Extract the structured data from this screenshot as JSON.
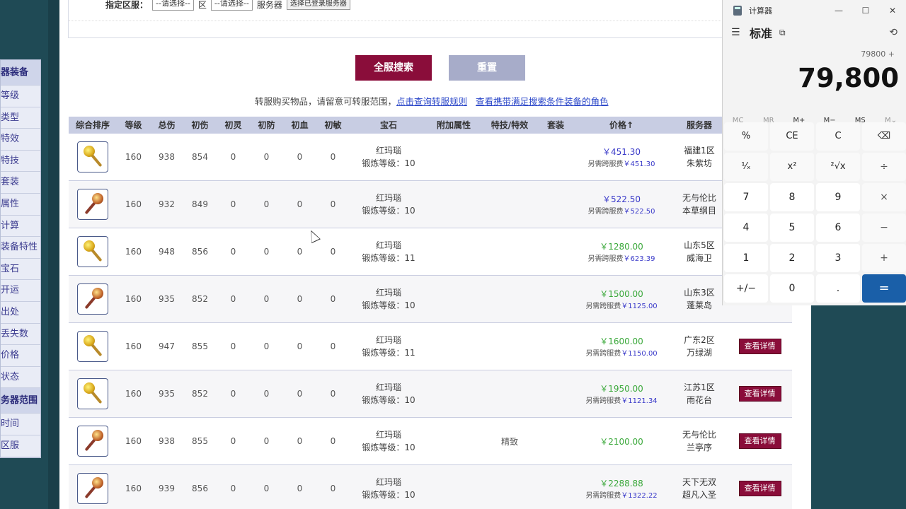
{
  "sidebar": {
    "items": [
      "器装备",
      "等级",
      "类型",
      "特效",
      "特技",
      "套装",
      "属性",
      "计算",
      "装备特性",
      "宝石",
      "开运",
      "出处",
      "丢失数",
      "价格",
      "状态",
      "务器范围",
      "时间",
      "区服"
    ]
  },
  "filter": {
    "label": "指定区服：",
    "select1": "--请选择--",
    "suffix1": "区",
    "select2": "--请选择--",
    "suffix2": "服务器",
    "pick_button": "选择已登录服务器"
  },
  "actions": {
    "search": "全服搜索",
    "reset": "重置"
  },
  "notice": {
    "text": "转服购买物品，请留意可转服范围，",
    "link1": "点击查询转服规则",
    "link2": "查看携带满足搜索条件装备的角色"
  },
  "table": {
    "headers": [
      "综合排序",
      "等级",
      "总伤",
      "初伤",
      "初灵",
      "初防",
      "初血",
      "初敏",
      "宝石",
      "附加属性",
      "特技/特效",
      "套装",
      "价格↑",
      "服务器",
      ""
    ],
    "rows": [
      {
        "lv": "160",
        "total": "938",
        "init": "854",
        "ling": "0",
        "fang": "0",
        "xue": "0",
        "min": "0",
        "gem": "红玛瑙",
        "forge": "锻炼等级：10",
        "extra": "",
        "special": "",
        "set": "",
        "price": "￥451.30",
        "price_color": "blue",
        "fee": "另需跨服费￥451.30",
        "server1": "福建1区",
        "server2": "朱紫坊",
        "detail": "",
        "icon": "staff1"
      },
      {
        "lv": "160",
        "total": "932",
        "init": "849",
        "ling": "0",
        "fang": "0",
        "xue": "0",
        "min": "0",
        "gem": "红玛瑙",
        "forge": "锻炼等级：10",
        "extra": "",
        "special": "",
        "set": "",
        "price": "￥522.50",
        "price_color": "blue",
        "fee": "另需跨服费￥522.50",
        "server1": "无与伦比",
        "server2": "本草纲目",
        "detail": "",
        "icon": "staff2"
      },
      {
        "lv": "160",
        "total": "948",
        "init": "856",
        "ling": "0",
        "fang": "0",
        "xue": "0",
        "min": "0",
        "gem": "红玛瑙",
        "forge": "锻炼等级：11",
        "extra": "",
        "special": "",
        "set": "",
        "price": "￥1280.00",
        "price_color": "green",
        "fee": "另需跨服费￥623.39",
        "server1": "山东5区",
        "server2": "威海卫",
        "detail": "",
        "icon": "staff1"
      },
      {
        "lv": "160",
        "total": "935",
        "init": "852",
        "ling": "0",
        "fang": "0",
        "xue": "0",
        "min": "0",
        "gem": "红玛瑙",
        "forge": "锻炼等级：10",
        "extra": "",
        "special": "",
        "set": "",
        "price": "￥1500.00",
        "price_color": "green",
        "fee": "另需跨服费￥1125.00",
        "server1": "山东3区",
        "server2": "蓬莱岛",
        "detail": "",
        "icon": "staff2"
      },
      {
        "lv": "160",
        "total": "947",
        "init": "855",
        "ling": "0",
        "fang": "0",
        "xue": "0",
        "min": "0",
        "gem": "红玛瑙",
        "forge": "锻炼等级：11",
        "extra": "",
        "special": "",
        "set": "",
        "price": "￥1600.00",
        "price_color": "green",
        "fee": "另需跨服费￥1150.00",
        "server1": "广东2区",
        "server2": "万绿湖",
        "detail": "查看详情",
        "icon": "staff1"
      },
      {
        "lv": "160",
        "total": "935",
        "init": "852",
        "ling": "0",
        "fang": "0",
        "xue": "0",
        "min": "0",
        "gem": "红玛瑙",
        "forge": "锻炼等级：10",
        "extra": "",
        "special": "",
        "set": "",
        "price": "￥1950.00",
        "price_color": "green",
        "fee": "另需跨服费￥1121.34",
        "server1": "江苏1区",
        "server2": "雨花台",
        "detail": "查看详情",
        "icon": "staff1"
      },
      {
        "lv": "160",
        "total": "938",
        "init": "855",
        "ling": "0",
        "fang": "0",
        "xue": "0",
        "min": "0",
        "gem": "红玛瑙",
        "forge": "锻炼等级：10",
        "extra": "",
        "special": "精致",
        "set": "",
        "price": "￥2100.00",
        "price_color": "green",
        "fee": "",
        "server1": "无与伦比",
        "server2": "兰亭序",
        "detail": "查看详情",
        "icon": "staff2"
      },
      {
        "lv": "160",
        "total": "939",
        "init": "856",
        "ling": "0",
        "fang": "0",
        "xue": "0",
        "min": "0",
        "gem": "红玛瑙",
        "forge": "锻炼等级：10",
        "extra": "",
        "special": "",
        "set": "",
        "price": "￥2288.88",
        "price_color": "green",
        "fee": "另需跨服费￥1322.22",
        "server1": "天下无双",
        "server2": "超凡入圣",
        "detail": "查看详情",
        "icon": "staff2"
      }
    ]
  },
  "calculator": {
    "title": "计算器",
    "mode": "标准",
    "keep_icon": "keep-on-top-icon",
    "expression": "79800 +",
    "display": "79,800",
    "memory": [
      "MC",
      "MR",
      "M+",
      "M−",
      "MS",
      "M⌄"
    ],
    "keys": [
      "%",
      "CE",
      "C",
      "⌫",
      "¹⁄ₓ",
      "x²",
      "²√x",
      "÷",
      "7",
      "8",
      "9",
      "×",
      "4",
      "5",
      "6",
      "−",
      "1",
      "2",
      "3",
      "+",
      "+/−",
      "0",
      ".",
      "="
    ]
  }
}
